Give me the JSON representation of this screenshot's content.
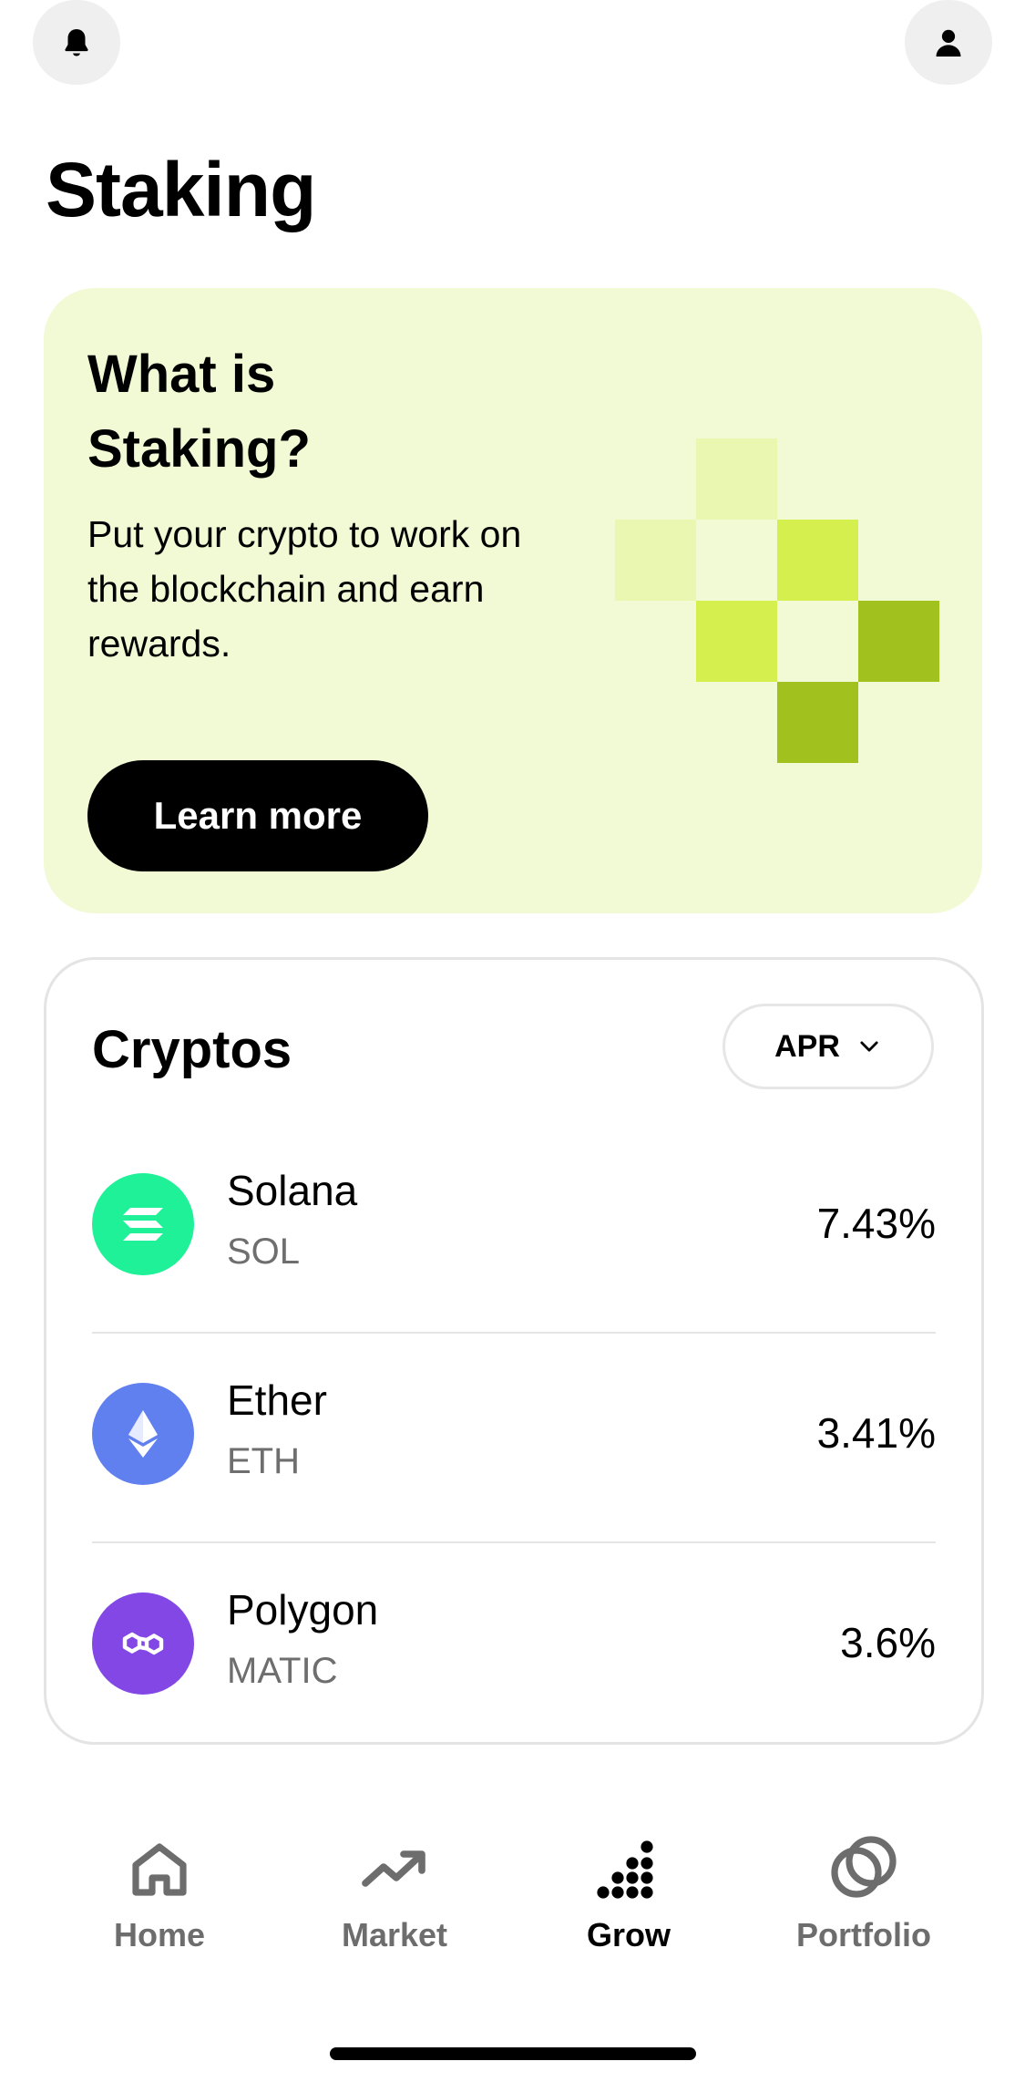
{
  "header": {
    "notifications_icon": "bell-icon",
    "profile_icon": "user-icon",
    "title": "Staking"
  },
  "promo": {
    "heading": "What is Staking?",
    "description": "Put your crypto to work on the blockchain and earn rewards.",
    "button_label": "Learn more",
    "colors": {
      "background": "#f1fad4",
      "tile_light": "#e9f7b0",
      "tile_mid": "#d5ef4f",
      "tile_dark": "#a1c11f"
    }
  },
  "cryptos": {
    "title": "Cryptos",
    "sort_select": {
      "selected": "APR",
      "icon": "chevron-down-icon"
    },
    "items": [
      {
        "name": "Solana",
        "symbol": "SOL",
        "apr": "7.43%",
        "logo_color": "#1ef197",
        "icon": "solana-icon"
      },
      {
        "name": "Ether",
        "symbol": "ETH",
        "apr": "3.41%",
        "logo_color": "#6180f0",
        "icon": "ethereum-icon"
      },
      {
        "name": "Polygon",
        "symbol": "MATIC",
        "apr": "3.6%",
        "logo_color": "#8247e5",
        "icon": "polygon-icon"
      }
    ]
  },
  "nav": {
    "items": [
      {
        "label": "Home",
        "icon": "home-icon",
        "active": false
      },
      {
        "label": "Market",
        "icon": "trending-up-icon",
        "active": false
      },
      {
        "label": "Grow",
        "icon": "grow-dots-icon",
        "active": true
      },
      {
        "label": "Portfolio",
        "icon": "portfolio-circles-icon",
        "active": false
      }
    ]
  }
}
